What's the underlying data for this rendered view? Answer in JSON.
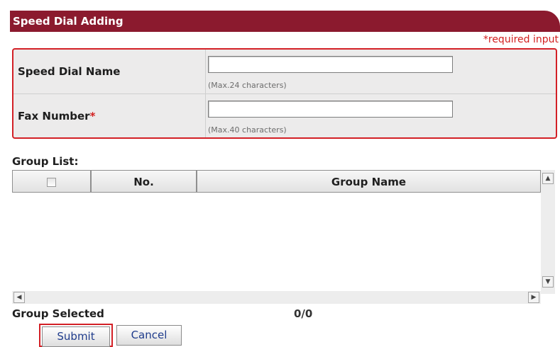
{
  "page": {
    "title": "Speed Dial Adding",
    "required_note": "*required input"
  },
  "form": {
    "speed_dial_name": {
      "label": "Speed Dial Name",
      "value": "",
      "hint": "(Max.24 characters)"
    },
    "fax_number": {
      "label": "Fax Number",
      "required_mark": "*",
      "value": "",
      "hint": "(Max.40 characters)"
    }
  },
  "group_list": {
    "label": "Group List:",
    "columns": [
      "",
      "No.",
      "Group Name"
    ],
    "rows": []
  },
  "group_selected": {
    "label": "Group Selected",
    "count": "0/0"
  },
  "buttons": {
    "submit": "Submit",
    "cancel": "Cancel"
  },
  "colors": {
    "title_bar": "#8b1a2e",
    "highlight_border": "#d32026",
    "required_text": "#d21f1f",
    "button_text": "#1f3c8c"
  },
  "icons": {
    "scroll_up": "scroll-up-arrow-icon",
    "scroll_down": "scroll-down-arrow-icon",
    "scroll_left": "scroll-left-arrow-icon",
    "scroll_right": "scroll-right-arrow-icon"
  }
}
